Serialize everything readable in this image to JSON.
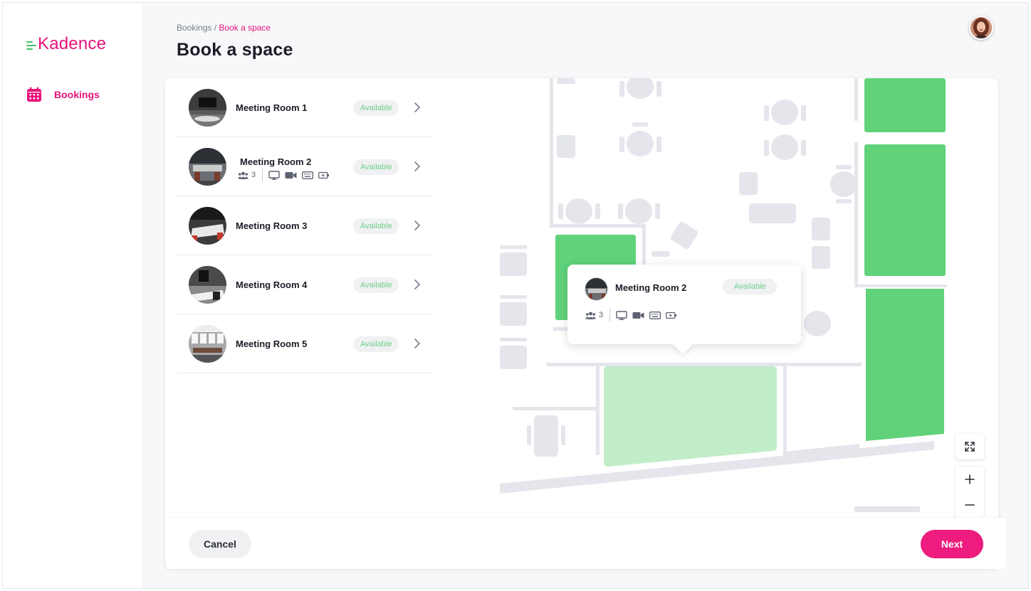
{
  "brand": {
    "name": "Kadence",
    "color": "#e8137a",
    "bars_color": "#43c168"
  },
  "sidebar": {
    "items": [
      {
        "label": "Bookings",
        "icon": "calendar-icon",
        "active": true
      }
    ]
  },
  "breadcrumb": {
    "parent": "Bookings",
    "separator": " / ",
    "current": "Book a space"
  },
  "page": {
    "title": "Book a space"
  },
  "rooms": [
    {
      "name": "Meeting Room 1",
      "status": "Available"
    },
    {
      "name": "Meeting Room 2",
      "status": "Available",
      "capacity": "3",
      "amenities": [
        "monitor-icon",
        "video-camera-icon",
        "keyboard-icon",
        "charging-icon"
      ]
    },
    {
      "name": "Meeting Room 3",
      "status": "Available"
    },
    {
      "name": "Meeting Room 4",
      "status": "Available"
    },
    {
      "name": "Meeting Room 5",
      "status": "Available"
    }
  ],
  "map_popup": {
    "name": "Meeting Room 2",
    "status": "Available",
    "capacity": "3",
    "amenities": [
      "monitor-icon",
      "video-camera-icon",
      "keyboard-icon",
      "charging-icon"
    ]
  },
  "map_controls": [
    "fullscreen-icon",
    "zoom-in-icon",
    "zoom-out-icon"
  ],
  "footer": {
    "cancel_label": "Cancel",
    "next_label": "Next"
  },
  "colors": {
    "accent": "#ee1c7e",
    "available_text": "#6fcf88",
    "room_available": "#5fd27a",
    "room_selected": "#c1edc9",
    "floor_plan": "#e4e6ec"
  }
}
